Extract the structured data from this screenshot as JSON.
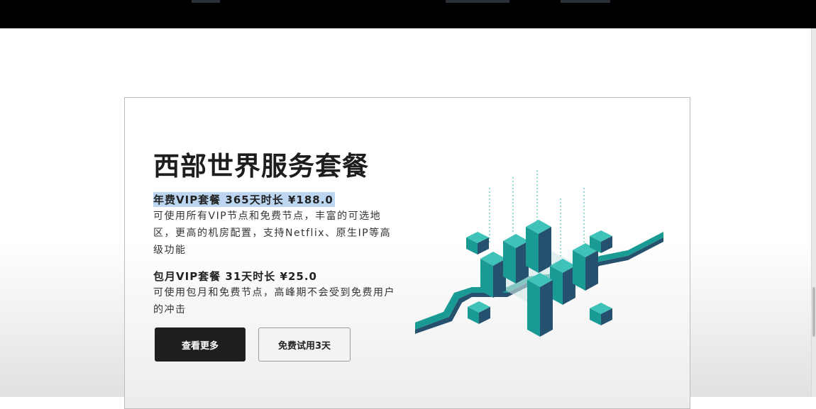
{
  "card": {
    "title": "西部世界服务套餐",
    "plans": [
      {
        "name": "年费VIP套餐 365天时长 ¥188.0",
        "description": "可使用所有VIP节点和免费节点，丰富的可选地区，更高的机房配置，支持Netflix、原生IP等高级功能"
      },
      {
        "name": "包月VIP套餐 31天时长 ¥25.0",
        "description": "可使用包月和免费节点，高峰期不会受到免费用户的冲击"
      }
    ],
    "buttons": {
      "primary_label": "查看更多",
      "secondary_label": "免费试用3天"
    }
  },
  "colors": {
    "top_bar": "#000000",
    "title_text": "#1d1d1d",
    "selection_highlight": "#bcd6f2",
    "primary_button": "#1f1f1f",
    "illustration_teal": "#1a9a94",
    "illustration_navy": "#25506e"
  },
  "icons": {
    "illustration": "server-city-illustration"
  }
}
